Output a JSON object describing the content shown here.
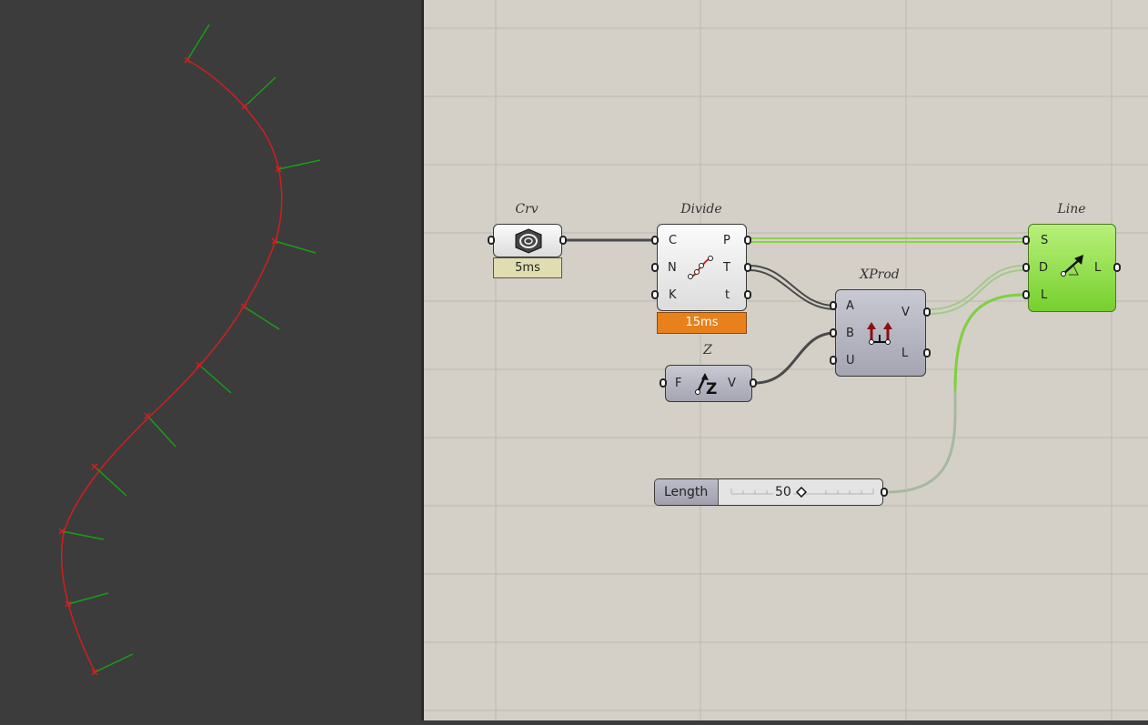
{
  "viewport": {
    "curve_color": "#d21e1e",
    "tangent_color": "#15a015",
    "background": "#3c3c3c"
  },
  "canvas": {
    "background": "#d4d0c8"
  },
  "components": {
    "crv": {
      "nickname": "Crv",
      "icon": "curve-param-icon",
      "timer": "5ms"
    },
    "divide": {
      "nickname": "Divide",
      "inputs": [
        "C",
        "N",
        "K"
      ],
      "outputs": [
        "P",
        "T",
        "t"
      ],
      "icon": "divide-curve-icon",
      "timer": "15ms"
    },
    "xprod": {
      "nickname": "XProd",
      "inputs": [
        "A",
        "B",
        "U"
      ],
      "outputs": [
        "V",
        "L"
      ],
      "icon": "cross-product-icon"
    },
    "z": {
      "nickname": "Z",
      "inputs": [
        "F"
      ],
      "outputs": [
        "V"
      ],
      "icon": "unit-z-icon"
    },
    "line": {
      "nickname": "Line",
      "inputs": [
        "S",
        "D",
        "L"
      ],
      "outputs": [
        "L"
      ],
      "icon": "line-sdl-icon",
      "color": "#8ee03c"
    },
    "slider": {
      "label": "Length",
      "value": "50",
      "fraction": 0.5
    }
  }
}
